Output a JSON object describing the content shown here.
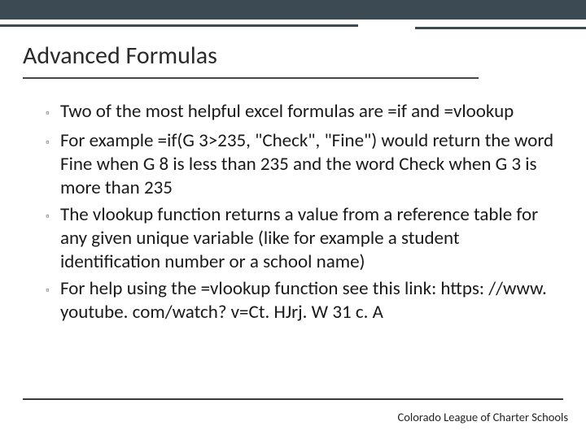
{
  "title": "Advanced Formulas",
  "bullets": [
    "Two of the most helpful excel formulas are =if and =vlookup",
    "For example =if(G 3>235, \"Check\", \"Fine\") would return the word Fine when G 8 is less than 235 and the word Check when G 3 is more than 235",
    "The vlookup function returns a value from a reference table for any given unique variable (like for example a student identification number or a school name)",
    "For help using the =vlookup function see this link: https: //www. youtube. com/watch? v=Ct. HJrj. W 31 c. A"
  ],
  "footer": "Colorado League of Charter Schools",
  "bullet_marker": "▫"
}
